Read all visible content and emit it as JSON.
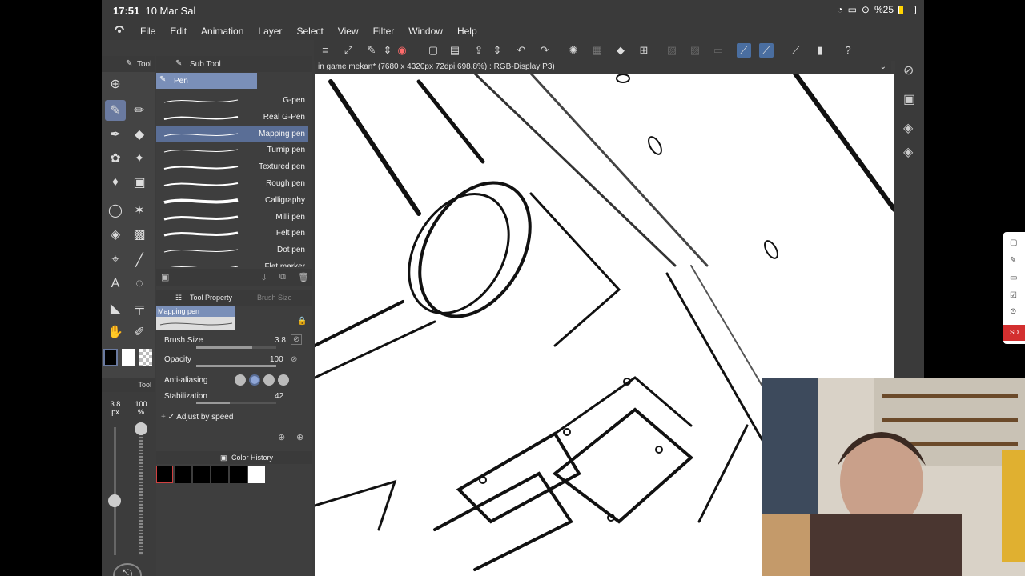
{
  "status": {
    "time": "17:51",
    "date": "10 Mar Sal",
    "battery": "%25"
  },
  "menu": [
    "File",
    "Edit",
    "Animation",
    "Layer",
    "Select",
    "View",
    "Filter",
    "Window",
    "Help"
  ],
  "panels": {
    "tool_tab": "Tool",
    "sub_tool_tab": "Sub Tool",
    "tool_property_tab": "Tool Property",
    "brush_size_tab": "Brush Size",
    "color_history_tab": "Color History",
    "tool_small": "Tool"
  },
  "subtool": {
    "group": "Pen",
    "brushes": [
      "G-pen",
      "Real G-Pen",
      "Mapping pen",
      "Turnip pen",
      "Textured pen",
      "Rough pen",
      "Calligraphy",
      "Milli pen",
      "Felt pen",
      "Dot pen",
      "Flat marker"
    ],
    "selected_index": 2
  },
  "property": {
    "preview_name": "Mapping pen",
    "brush_size_label": "Brush Size",
    "brush_size_value": "3.8",
    "opacity_label": "Opacity",
    "opacity_value": "100",
    "antialias_label": "Anti-aliasing",
    "stabilization_label": "Stabilization",
    "stabilization_value": "42",
    "adjust_label": "Adjust by speed",
    "brush_size_level": 0.7,
    "opacity_level": 1.0,
    "stabilization_level": 0.42
  },
  "mini": {
    "size": "3.8 px",
    "opacity": "100 %"
  },
  "canvas_title": "in game mekan* (7680 x 4320px 72dpi 698.8%) : RGB-Display P3)",
  "colors": {
    "accent": "#6a7aa0",
    "selected_row": "#5a6e96",
    "panel": "#3e3e3e"
  },
  "right_edge_badge": "SD"
}
